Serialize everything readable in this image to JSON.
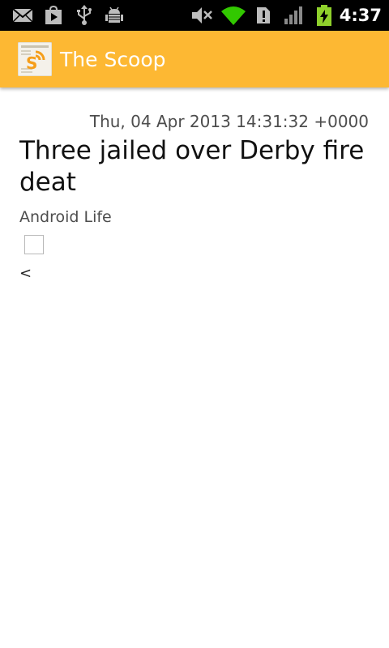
{
  "status_bar": {
    "time": "4:37",
    "icons": [
      "gmail-icon",
      "play-store-icon",
      "usb-icon",
      "android-debug-icon",
      "volume-muted-icon",
      "wifi-icon",
      "sim-alert-icon",
      "signal-icon",
      "battery-charging-icon"
    ]
  },
  "action_bar": {
    "title": "The Scoop",
    "logo_icon": "the-scoop-logo-icon"
  },
  "article": {
    "date": "Thu, 04 Apr 2013 14:31:32 +0000",
    "title": "Three jailed over Derby fire deat",
    "source": "Android Life",
    "body": "<"
  },
  "colors": {
    "action_bar": "#fdb833",
    "status_bar": "#000000",
    "wifi_green": "#32c800",
    "battery_green": "#8fd12c"
  }
}
